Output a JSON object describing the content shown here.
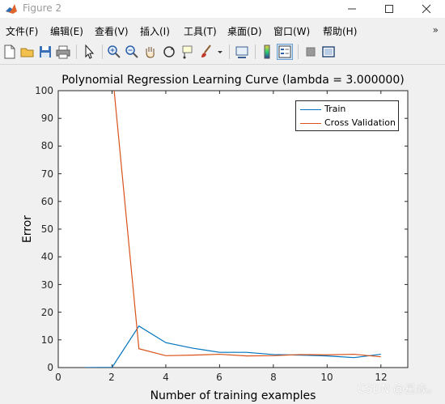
{
  "window": {
    "title": "Figure 2"
  },
  "menu": [
    "文件(F)",
    "编辑(E)",
    "查看(V)",
    "插入(I)",
    "工具(T)",
    "桌面(D)",
    "窗口(W)",
    "帮助(H)"
  ],
  "menu_overflow": "»",
  "toolbar": [
    "new-figure-icon",
    "open-icon",
    "save-icon",
    "print-icon",
    "pointer-icon",
    "zoom-in-icon",
    "zoom-out-icon",
    "pan-icon",
    "rotate-3d-icon",
    "data-cursor-icon",
    "brush-icon",
    "brush-dropdown-icon",
    "link-plot-icon",
    "colorbar-icon",
    "legend-icon",
    "hide-plot-tools-icon",
    "show-plot-tools-icon"
  ],
  "watermark": "CSDN @星焱。",
  "colors": {
    "train": "#0072bd",
    "cv": "#d95319"
  },
  "chart_data": {
    "type": "line",
    "title": "Polynomial Regression Learning Curve (lambda = 3.000000)",
    "xlabel": "Number of training examples",
    "ylabel": "Error",
    "xlim": [
      0,
      13
    ],
    "ylim": [
      0,
      100
    ],
    "xticks": [
      "0",
      "2",
      "4",
      "6",
      "8",
      "10",
      "12"
    ],
    "yticks": [
      "0",
      "10",
      "20",
      "30",
      "40",
      "50",
      "60",
      "70",
      "80",
      "90",
      "100"
    ],
    "x": [
      1,
      2,
      3,
      4,
      5,
      6,
      7,
      8,
      9,
      10,
      11,
      12
    ],
    "series": [
      {
        "name": "Train",
        "values": [
          0,
          0.05,
          15,
          9,
          7,
          5.5,
          5.5,
          4.7,
          4.5,
          4.2,
          3.6,
          4.8
        ]
      },
      {
        "name": "Cross Validation",
        "values": [
          140,
          108,
          6.8,
          4.3,
          4.5,
          4.8,
          4.2,
          4.3,
          4.7,
          4.6,
          4.8,
          3.9
        ]
      }
    ],
    "legend_position": "top-right",
    "grid": false
  }
}
